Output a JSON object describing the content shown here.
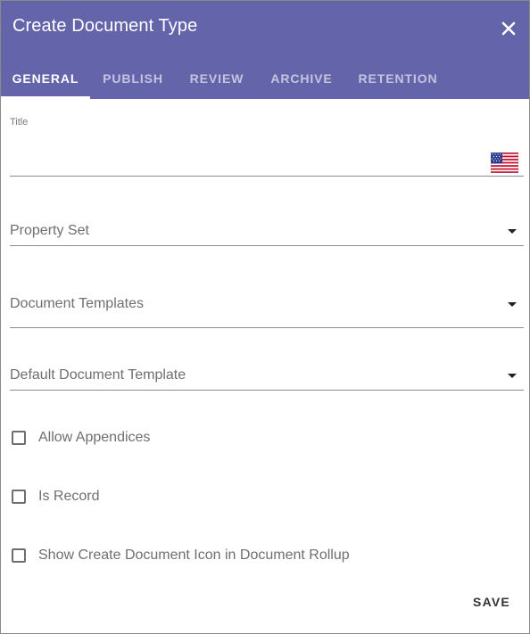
{
  "dialog": {
    "title": "Create Document Type",
    "close_icon": "close-icon"
  },
  "tabs": [
    {
      "label": "GENERAL",
      "active": true
    },
    {
      "label": "PUBLISH",
      "active": false
    },
    {
      "label": "REVIEW",
      "active": false
    },
    {
      "label": "ARCHIVE",
      "active": false
    },
    {
      "label": "RETENTION",
      "active": false
    }
  ],
  "fields": {
    "title": {
      "label": "Title",
      "value": "",
      "language_icon": "us-flag-icon"
    },
    "property_set": {
      "label": "Property Set",
      "value": ""
    },
    "document_templates": {
      "label": "Document Templates",
      "value": ""
    },
    "default_document_template": {
      "label": "Default Document Template",
      "value": ""
    }
  },
  "checkboxes": [
    {
      "label": "Allow Appendices",
      "checked": false
    },
    {
      "label": "Is Record",
      "checked": false
    },
    {
      "label": "Show Create Document Icon in Document Rollup",
      "checked": false
    }
  ],
  "actions": {
    "save_label": "SAVE"
  },
  "colors": {
    "header": "#6464aa",
    "tab_active": "#ffffff",
    "tab_inactive": "rgba(255,255,255,0.62)",
    "text_muted": "#6f6f6f"
  }
}
